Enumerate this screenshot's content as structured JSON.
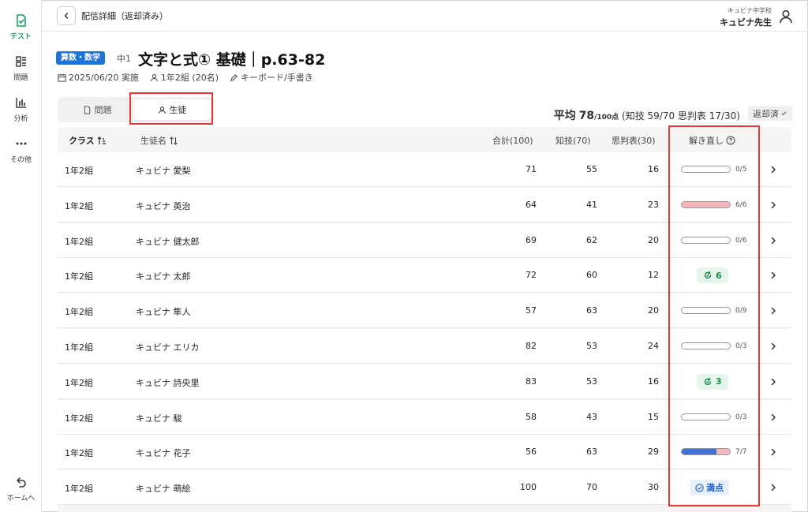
{
  "sidebar": {
    "items": [
      {
        "label": "テスト",
        "icon": "test-check-icon",
        "active": true
      },
      {
        "label": "問題",
        "icon": "grid-list-icon",
        "active": false
      },
      {
        "label": "分析",
        "icon": "bar-chart-icon",
        "active": false
      },
      {
        "label": "その他",
        "icon": "more-dots-icon",
        "active": false
      }
    ],
    "home_label": "ホームへ"
  },
  "header": {
    "title": "配信詳細（返却済み）",
    "school": "キュビナ中学校",
    "teacher": "キュビナ先生"
  },
  "test": {
    "subject": "算数・数学",
    "grade": "中1",
    "title": "文字と式① 基礎｜p.63-82",
    "date": "2025/06/20 実施",
    "class_info": "1年2組 (20名)",
    "input_mode": "キーボード/手書き"
  },
  "tabs": [
    {
      "label": "問題",
      "active": false
    },
    {
      "label": "生徒",
      "active": true
    }
  ],
  "summary": {
    "avg_prefix": "平均",
    "avg_value": "78",
    "avg_unit": "/100点",
    "detail": "(知技 59/70 思判表 17/30)",
    "returned_label": "返却済"
  },
  "table": {
    "headers": {
      "class": "クラス",
      "name": "生徒名",
      "total": "合計(100)",
      "chigi": "知技(70)",
      "shihan": "思判表(30)",
      "retry": "解き直し"
    },
    "rows": [
      {
        "class": "1年2組",
        "name": "キュビナ 愛梨",
        "total": "71",
        "chigi": "55",
        "shihan": "16",
        "retry_type": "progress",
        "done": 0,
        "wrong": 0,
        "max": 5,
        "label": "0/5"
      },
      {
        "class": "1年2組",
        "name": "キュビナ 英治",
        "total": "64",
        "chigi": "41",
        "shihan": "23",
        "retry_type": "progress",
        "done": 0,
        "wrong": 6,
        "max": 6,
        "label": "6/6"
      },
      {
        "class": "1年2組",
        "name": "キュビナ 健太郎",
        "total": "69",
        "chigi": "62",
        "shihan": "20",
        "retry_type": "progress",
        "done": 0,
        "wrong": 0,
        "max": 6,
        "label": "0/6"
      },
      {
        "class": "1年2組",
        "name": "キュビナ 太郎",
        "total": "72",
        "chigi": "60",
        "shihan": "12",
        "retry_type": "retry",
        "label": "6"
      },
      {
        "class": "1年2組",
        "name": "キュビナ 隼人",
        "total": "57",
        "chigi": "63",
        "shihan": "20",
        "retry_type": "progress",
        "done": 0,
        "wrong": 0,
        "max": 9,
        "label": "0/9"
      },
      {
        "class": "1年2組",
        "name": "キュビナ エリカ",
        "total": "82",
        "chigi": "53",
        "shihan": "24",
        "retry_type": "progress",
        "done": 0,
        "wrong": 0,
        "max": 3,
        "label": "0/3"
      },
      {
        "class": "1年2組",
        "name": "キュビナ 詩央里",
        "total": "83",
        "chigi": "53",
        "shihan": "16",
        "retry_type": "retry",
        "label": "3"
      },
      {
        "class": "1年2組",
        "name": "キュビナ 駿",
        "total": "58",
        "chigi": "43",
        "shihan": "15",
        "retry_type": "progress",
        "done": 0,
        "wrong": 0,
        "max": 3,
        "label": "0/3"
      },
      {
        "class": "1年2組",
        "name": "キュビナ 花子",
        "total": "56",
        "chigi": "63",
        "shihan": "29",
        "retry_type": "progress",
        "done": 5,
        "wrong": 2,
        "max": 7,
        "label": "7/7"
      },
      {
        "class": "1年2組",
        "name": "キュビナ 萌絵",
        "total": "100",
        "chigi": "70",
        "shihan": "30",
        "retry_type": "full",
        "label": "満点"
      }
    ]
  },
  "colors": {
    "accent_green": "#1a9e5c",
    "subject_blue": "#1f73d9",
    "highlight_red": "#e23a3a",
    "progress_blue": "#3e72d6",
    "progress_red": "#f2b8bc"
  }
}
